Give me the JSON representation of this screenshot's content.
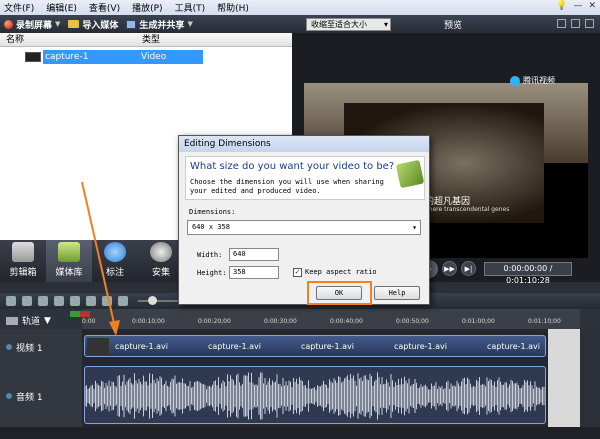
{
  "menu": {
    "items": [
      "文件(F)",
      "编辑(E)",
      "查看(V)",
      "播放(P)",
      "工具(T)",
      "帮助(H)"
    ]
  },
  "toolbar": {
    "record_label": "录制屏幕",
    "import_label": "导入媒体",
    "share_label": "生成并共享"
  },
  "media": {
    "col_name": "名称",
    "col_type": "类型",
    "items": [
      {
        "name": "capture-1",
        "type": "Video"
      }
    ]
  },
  "tabs": [
    "剪辑箱",
    "媒体库",
    "标注",
    "安集"
  ],
  "preview": {
    "zoom": "收缩至适合大小",
    "label": "预览",
    "watermark": "腾讯视频",
    "subtitle_cn": "的超凡基因",
    "subtitle_en": "There transcendental genes",
    "timecode": "0:00:00:00 / 0:01:10:28"
  },
  "timeline": {
    "tracks_label": "轨道",
    "ruler": [
      "0:00",
      "0:00:10;00",
      "0:00:20;00",
      "0:00:30;00",
      "0:00:40;00",
      "0:00:50;00",
      "0:01:00;00",
      "0:01:10;00"
    ],
    "video_track": "视频 1",
    "audio_track": "音频 1",
    "clip_names": [
      "capture-1.avi",
      "capture-1.avi",
      "capture-1.avi",
      "capture-1.avi",
      "capture-1.avi"
    ]
  },
  "dialog": {
    "title": "Editing Dimensions",
    "question": "What size do you want your video to be?",
    "description": "Choose the dimension you will use when sharing your edited and produced video.",
    "dimensions_label": "Dimensions:",
    "dimensions_value": "640 x 358",
    "width_label": "Width:",
    "width_value": "640",
    "height_label": "Height:",
    "height_value": "358",
    "keep_aspect_label": "Keep aspect ratio",
    "ok_label": "OK",
    "help_label": "Help"
  },
  "colors": {
    "accent_highlight": "#f08020",
    "selection": "#3399ff"
  }
}
